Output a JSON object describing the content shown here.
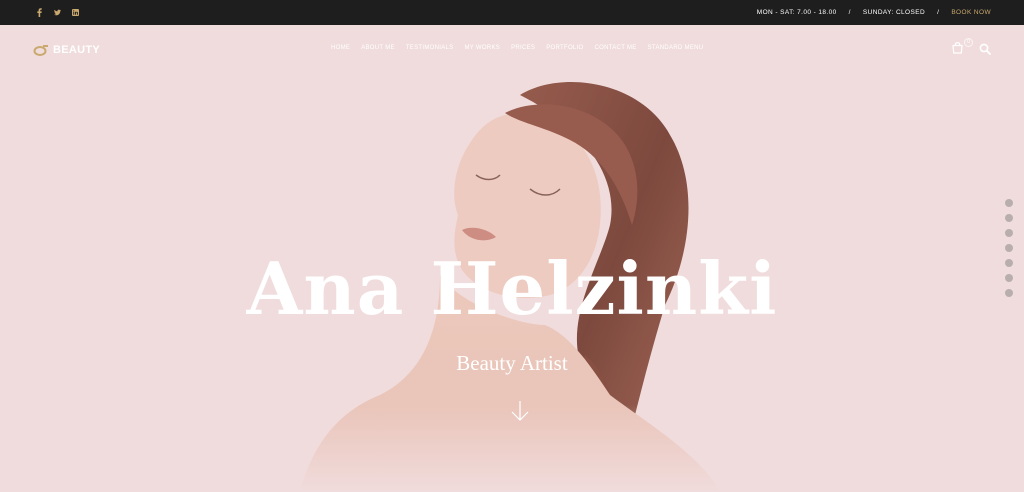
{
  "topbar": {
    "socials": [
      {
        "icon": "facebook-icon",
        "glyph": "f"
      },
      {
        "icon": "twitter-icon",
        "glyph": ""
      },
      {
        "icon": "linkedin-icon",
        "glyph": "in"
      }
    ],
    "hours": "MON - SAT: 7.00 - 18.00",
    "sunday": "SUNDAY: CLOSED",
    "book_now": "BOOK NOW",
    "accent_color": "#c9a96e"
  },
  "header": {
    "logo_text": "BEAUTY",
    "nav": [
      "HOME",
      "ABOUT ME",
      "TESTIMONIALS",
      "MY WORKS",
      "PRICES",
      "PORTFOLIO",
      "CONTACT ME",
      "STANDARD MENU"
    ],
    "cart_count": "0"
  },
  "hero": {
    "title": "Ana Helzinki",
    "subtitle": "Beauty Artist",
    "background_color": "#f1dcdc",
    "dots_count": 7
  }
}
